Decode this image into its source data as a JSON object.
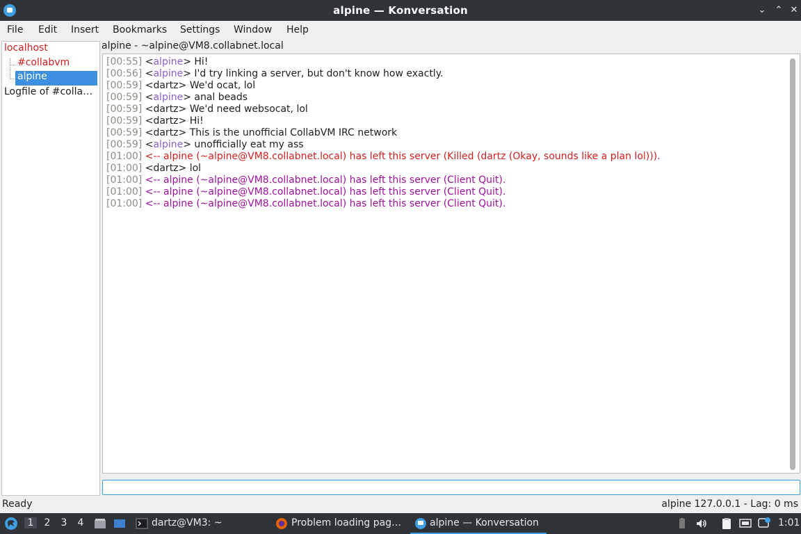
{
  "window": {
    "title": "alpine — Konversation",
    "controls": [
      "⌄",
      "⌃",
      "✕"
    ]
  },
  "menu": [
    "File",
    "Edit",
    "Insert",
    "Bookmarks",
    "Settings",
    "Window",
    "Help"
  ],
  "tree": {
    "server": "localhost",
    "channel": "#collabvm",
    "query": "alpine",
    "logfile": "Logfile of #collab…"
  },
  "chat": {
    "header": "alpine - ~alpine@VM8.collabnet.local",
    "lines": [
      {
        "ts": "[00:55]",
        "type": "msg",
        "nick": "alpine",
        "text": " Hi!"
      },
      {
        "ts": "[00:56]",
        "type": "msg",
        "nick": "alpine",
        "text": " I'd try linking a server, but don't know how exactly."
      },
      {
        "ts": "[00:59]",
        "type": "msg",
        "nick": "dartz",
        "text": " We'd ocat, lol"
      },
      {
        "ts": "[00:59]",
        "type": "msg",
        "nick": "alpine",
        "text": " anal beads"
      },
      {
        "ts": "[00:59]",
        "type": "msg",
        "nick": "dartz",
        "text": " We'd need websocat, lol"
      },
      {
        "ts": "[00:59]",
        "type": "msg",
        "nick": "dartz",
        "text": " Hi!"
      },
      {
        "ts": "[00:59]",
        "type": "msg",
        "nick": "dartz",
        "text": " This is the unofficial CollabVM IRC network"
      },
      {
        "ts": "[00:59]",
        "type": "msg",
        "nick": "alpine",
        "text": " unofficially eat my ass"
      },
      {
        "ts": "[01:00]",
        "type": "quit-red",
        "text": "<-- alpine (~alpine@VM8.collabnet.local) has left this server (Killed (dartz (Okay, sounds like a plan lol)))."
      },
      {
        "ts": "[01:00]",
        "type": "msg",
        "nick": "dartz",
        "text": " lol"
      },
      {
        "ts": "[01:00]",
        "type": "quit",
        "text": "<-- alpine (~alpine@VM8.collabnet.local) has left this server (Client Quit)."
      },
      {
        "ts": "[01:00]",
        "type": "quit",
        "text": "<-- alpine (~alpine@VM8.collabnet.local) has left this server (Client Quit)."
      },
      {
        "ts": "[01:00]",
        "type": "quit",
        "text": "<-- alpine (~alpine@VM8.collabnet.local) has left this server (Client Quit)."
      }
    ],
    "input_value": ""
  },
  "status": {
    "left": "Ready",
    "right": "alpine  127.0.0.1 - Lag: 0 ms"
  },
  "taskbar": {
    "desktops": [
      "1",
      "2",
      "3",
      "4"
    ],
    "terminal": "dartz@VM3: ~",
    "firefox": "Problem loading pag…",
    "konversation": "alpine — Konversation",
    "clock": "1:01"
  },
  "colors": {
    "accent": "#3d9ee3",
    "nick_alpine": "#8e5fc8",
    "quit_red": "#d32020",
    "quit_purple": "#a0119e",
    "timestamp": "#8b8f85"
  }
}
